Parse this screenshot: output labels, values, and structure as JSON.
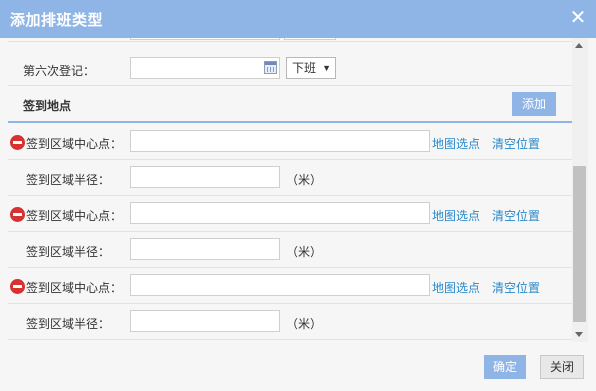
{
  "dialog": {
    "title": "添加排班类型",
    "close_symbol": "✕"
  },
  "registration": {
    "label": "第六次登记：",
    "time_value": "",
    "shift_select": "下班",
    "arrow": "▼"
  },
  "section": {
    "title": "签到地点",
    "add_label": "添加"
  },
  "locations": [
    {
      "center_label": "签到区域中心点：",
      "center_value": "",
      "map_pick": "地图选点",
      "clear": "清空位置",
      "radius_label": "签到区域半径：",
      "radius_value": "",
      "unit": "（米）"
    },
    {
      "center_label": "签到区域中心点：",
      "center_value": "",
      "map_pick": "地图选点",
      "clear": "清空位置",
      "radius_label": "签到区域半径：",
      "radius_value": "",
      "unit": "（米）"
    },
    {
      "center_label": "签到区域中心点：",
      "center_value": "",
      "map_pick": "地图选点",
      "clear": "清空位置",
      "radius_label": "签到区域半径：",
      "radius_value": "",
      "unit": "（米）"
    }
  ],
  "footer": {
    "ok_label": "确定",
    "close_label": "关闭"
  },
  "colors": {
    "titlebar": "#8fb5e6",
    "link": "#2b89c9",
    "remove": "#d93030"
  },
  "icons": {
    "close": "close-icon",
    "calendar": "calendar-icon",
    "remove": "remove-icon"
  }
}
